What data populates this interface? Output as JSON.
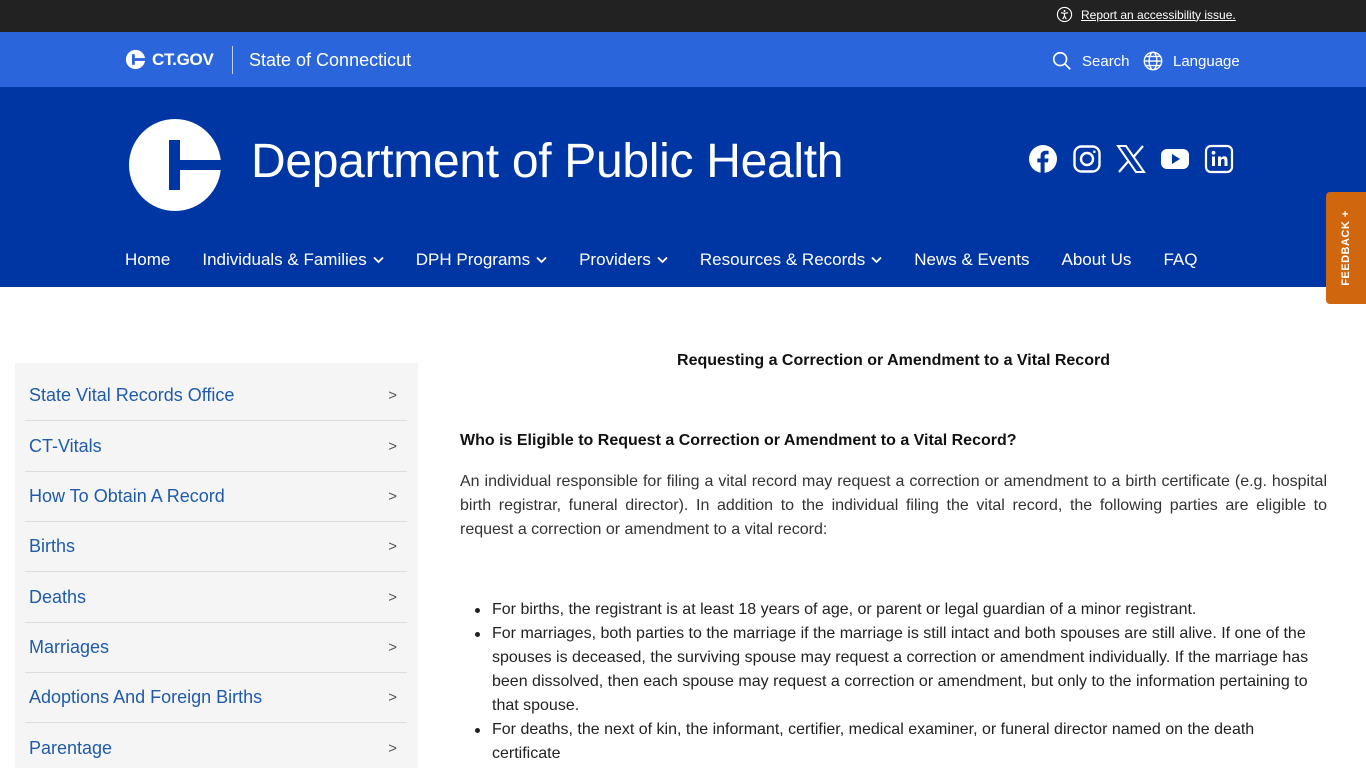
{
  "utility": {
    "accessibility_link": "Report an accessibility issue."
  },
  "gov_bar": {
    "logo_text": "CT.GOV",
    "state_name": "State of Connecticut",
    "search_label": "Search",
    "language_label": "Language"
  },
  "agency": {
    "name": "Department of Public Health",
    "social_icons": [
      "facebook-icon",
      "instagram-icon",
      "x-icon",
      "youtube-icon",
      "linkedin-icon"
    ]
  },
  "nav": {
    "items": [
      {
        "label": "Home",
        "has_dropdown": false
      },
      {
        "label": "Individuals & Families",
        "has_dropdown": true
      },
      {
        "label": "DPH Programs",
        "has_dropdown": true
      },
      {
        "label": "Providers",
        "has_dropdown": true
      },
      {
        "label": "Resources & Records",
        "has_dropdown": true
      },
      {
        "label": "News & Events",
        "has_dropdown": false
      },
      {
        "label": "About Us",
        "has_dropdown": false
      },
      {
        "label": "FAQ",
        "has_dropdown": false
      }
    ]
  },
  "feedback": {
    "label": "FEEDBACK +"
  },
  "sidebar": {
    "chevron": ">",
    "items": [
      {
        "label": "State Vital Records Office"
      },
      {
        "label": "CT-Vitals"
      },
      {
        "label": "How To Obtain A Record"
      },
      {
        "label": "Births"
      },
      {
        "label": "Deaths"
      },
      {
        "label": "Marriages"
      },
      {
        "label": "Adoptions And Foreign Births"
      },
      {
        "label": "Parentage"
      }
    ]
  },
  "main": {
    "title": "Requesting a Correction or Amendment to a Vital Record",
    "section_heading": "Who is Eligible to Request a Correction or Amendment to a Vital Record?",
    "intro": "An individual responsible for filing a vital record may request a correction or amendment to a birth certificate (e.g. hospital birth registrar, funeral director). In addition to the individual filing the vital record, the following parties are eligible to request a correction or amendment to a vital record:",
    "bullets": [
      "For births, the registrant is at least 18 years of age, or parent or legal guardian of a minor registrant.",
      "For marriages, both parties to the marriage if the marriage is still intact and both spouses are still alive. If one of the spouses is deceased, the surviving spouse may request a correction or amendment individually. If the marriage has been dissolved, then each spouse may request a correction or amendment, but only to the information pertaining to that spouse.",
      "For deaths, the next of kin, the informant, certifier, medical examiner, or funeral director named on the death certificate"
    ]
  },
  "colors": {
    "utility_bg": "#222222",
    "gov_bar_bg": "#2a65dc",
    "agency_bg": "#0036a3",
    "feedback_bg": "#d0670e",
    "link": "#1f5ba8",
    "sidebar_bg": "#f5f5f5"
  }
}
